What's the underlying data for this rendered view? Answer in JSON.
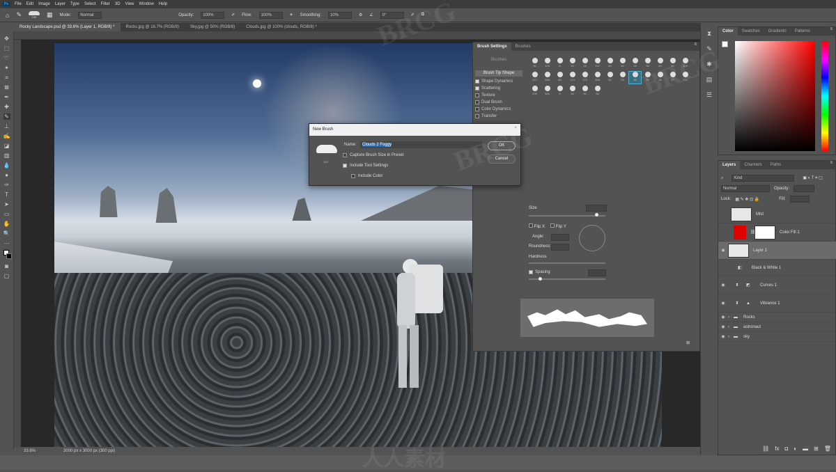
{
  "menu": {
    "logo": "Ps",
    "items": [
      "File",
      "Edit",
      "Image",
      "Layer",
      "Type",
      "Select",
      "Filter",
      "3D",
      "View",
      "Window",
      "Help"
    ]
  },
  "options": {
    "mode_label": "Mode:",
    "mode": "Normal",
    "opacity_label": "Opacity:",
    "opacity": "100%",
    "flow_label": "Flow:",
    "flow": "100%",
    "smoothing_label": "Smoothing:",
    "smoothing": "10%",
    "angle": "0°",
    "brush_size": "100"
  },
  "tabs": [
    "Rocky Landscape.psd @ 33.6% (Layer 1, RGB/8) *",
    "Rocks.jpg @ 16.7% (RGB/8)",
    "Sky.jpg @ 50% (RGB/8)",
    "Clouds.jpg @ 100% (clouds, RGB/8) *"
  ],
  "status": {
    "zoom": "33.6%",
    "doc": "3000 px x 3000 px (300 ppi)"
  },
  "dialog": {
    "title": "New Brush",
    "name_label": "Name:",
    "name_value": "Clouds 2 Foggy",
    "preview_size": "100",
    "capture_size": "Capture Brush Size in Preset",
    "capture_checked": false,
    "include_tool": "Include Tool Settings",
    "include_tool_checked": true,
    "include_color": "Include Color",
    "include_color_checked": false,
    "ok": "OK",
    "cancel": "Cancel"
  },
  "brush_settings": {
    "tabs": [
      "Brush Settings",
      "Brushes"
    ],
    "brushes_button": "Brushes",
    "tip_shape": "Brush Tip Shape",
    "options": [
      {
        "label": "Shape Dynamics",
        "checked": true
      },
      {
        "label": "Scattering",
        "checked": true
      },
      {
        "label": "Texture",
        "checked": false
      },
      {
        "label": "Dual Brush",
        "checked": false
      },
      {
        "label": "Color Dynamics",
        "checked": false
      },
      {
        "label": "Transfer",
        "checked": false
      }
    ],
    "tip_sizes": [
      "30",
      "123",
      "8",
      "10",
      "25",
      "112",
      "60",
      "50",
      "25",
      "30",
      "50",
      "60",
      "100",
      "127",
      "284",
      "80",
      "174",
      "175",
      "306",
      "50",
      "25",
      "36",
      "25",
      "36",
      "27",
      "100",
      "200",
      "300",
      "9",
      "30",
      "30",
      "30"
    ],
    "selected_tip": 21,
    "size_label": "Size",
    "flip_x": "Flip X",
    "flip_y": "Flip Y",
    "angle_label": "Angle:",
    "roundness_label": "Roundness:",
    "hardness_label": "Hardness",
    "spacing_label": "Spacing",
    "spacing_checked": true
  },
  "color": {
    "tabs": [
      "Color",
      "Swatches",
      "Gradients",
      "Patterns"
    ],
    "foreground": "#ffffff",
    "background": "#000000"
  },
  "layers": {
    "tabs": [
      "Layers",
      "Channels",
      "Paths"
    ],
    "kind_label": "Kind",
    "blend": "Normal",
    "opacity_label": "Opacity:",
    "lock_label": "Lock:",
    "fill_label": "Fill:",
    "items": [
      {
        "name": "Mist",
        "visible": false
      },
      {
        "name": "Color Fill 1",
        "visible": false,
        "fill": "#e00000"
      },
      {
        "name": "Layer 1",
        "visible": true,
        "selected": true
      },
      {
        "name": "Black & White 1",
        "visible": false
      },
      {
        "name": "Curves 1",
        "visible": true
      },
      {
        "name": "Vibrance 1",
        "visible": true
      },
      {
        "name": "Rocks",
        "visible": true,
        "group": true
      },
      {
        "name": "astronaut",
        "visible": true,
        "group": true
      },
      {
        "name": "sky",
        "visible": true,
        "group": true
      }
    ]
  },
  "watermark": "BRCG"
}
